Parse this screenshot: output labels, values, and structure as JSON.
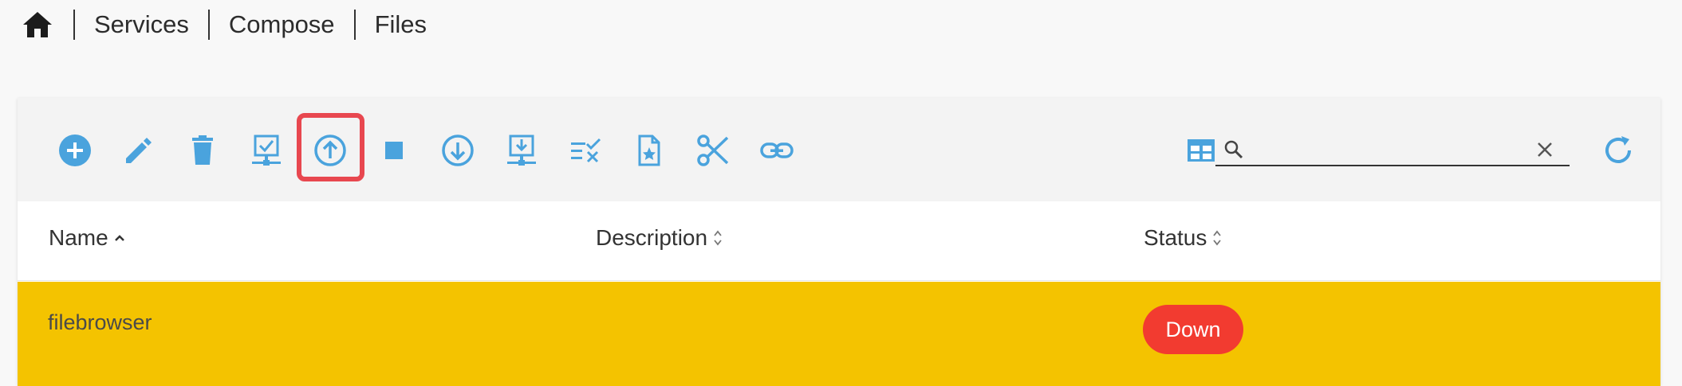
{
  "breadcrumb": {
    "home_icon": "home-icon",
    "items": [
      "Services",
      "Compose",
      "Files"
    ]
  },
  "toolbar": {
    "accent": "#4aa3dd",
    "highlight_color": "#e8474f",
    "highlighted_button": "start-button",
    "buttons": [
      {
        "name": "add-button",
        "icon": "plus-circle-icon"
      },
      {
        "name": "edit-button",
        "icon": "pencil-icon"
      },
      {
        "name": "delete-button",
        "icon": "trash-icon"
      },
      {
        "name": "validate-button",
        "icon": "monitor-check-icon"
      },
      {
        "name": "start-button",
        "icon": "arrow-up-circle-icon"
      },
      {
        "name": "stop-button",
        "icon": "stop-square-icon"
      },
      {
        "name": "pull-button",
        "icon": "arrow-down-circle-icon"
      },
      {
        "name": "install-button",
        "icon": "monitor-download-icon"
      },
      {
        "name": "checklist-button",
        "icon": "list-check-icon"
      },
      {
        "name": "file-star-button",
        "icon": "file-star-icon"
      },
      {
        "name": "cut-button",
        "icon": "scissors-icon"
      },
      {
        "name": "link-button",
        "icon": "link-icon"
      }
    ],
    "view_toggle_icon": "table-view-icon",
    "search": {
      "value": "",
      "placeholder": ""
    },
    "refresh_icon": "refresh-icon"
  },
  "table": {
    "columns": [
      {
        "label": "Name",
        "sort": "asc"
      },
      {
        "label": "Description",
        "sort": "none"
      },
      {
        "label": "Status",
        "sort": "none"
      }
    ],
    "rows": [
      {
        "name": "filebrowser",
        "description": "",
        "status": "Down",
        "row_color": "#f4c300",
        "status_color": "#f23b30"
      }
    ]
  }
}
